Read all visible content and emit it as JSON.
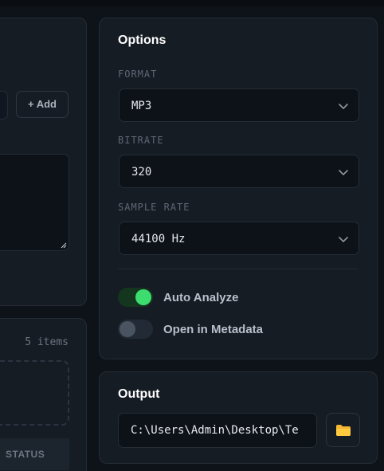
{
  "left_panel": {
    "add_button_label": "+ Add",
    "items_count": "5 items",
    "table_header_status": "STATUS"
  },
  "options": {
    "title": "Options",
    "format": {
      "label": "FORMAT",
      "value": "MP3"
    },
    "bitrate": {
      "label": "BITRATE",
      "value": "320"
    },
    "sample_rate": {
      "label": "SAMPLE RATE",
      "value": "44100 Hz"
    },
    "toggles": [
      {
        "label": "Auto Analyze",
        "on": true
      },
      {
        "label": "Open in Metadata",
        "on": false
      }
    ]
  },
  "output": {
    "title": "Output",
    "path": "C:\\Users\\Admin\\Desktop\\Te"
  },
  "colors": {
    "accent_green": "#3ddc6e",
    "folder_icon": "#f5b731"
  }
}
